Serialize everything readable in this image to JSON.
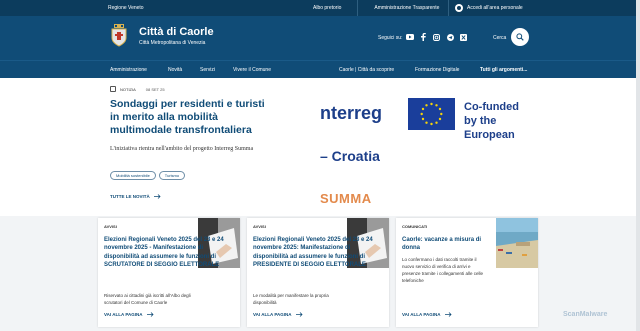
{
  "topbar": {
    "region": "Regione Veneto",
    "links": [
      "Albo pretorio",
      "Amministrazione Trasparente"
    ],
    "login": "Accedi all'area personale"
  },
  "header": {
    "site_name": "Città di Caorle",
    "site_sub": "Città Metropolitana di Venezia",
    "follow_label": "Seguici su:",
    "social_icons": [
      "youtube-icon",
      "facebook-icon",
      "instagram-icon",
      "telegram-icon",
      "x-icon"
    ],
    "search_label": "Cerca"
  },
  "nav": {
    "left": [
      "Amministrazione",
      "Novità",
      "Servizi",
      "Vivere il Comune"
    ],
    "right": [
      "Caorle | Città da scoprire",
      "Formazione Digitale"
    ],
    "all_topics": "Tutti gli argomenti..."
  },
  "hero": {
    "badge": "NOTIZIA",
    "date": "08 SET 25",
    "title": "Sondaggi per residenti e turisti in merito alla mobilità multimodale transfrontaliera",
    "description": "L'iniziativa rientra nell'ambito del progetto Interreg Summa",
    "chips": [
      "Mobilità sostenibile",
      "Turismo"
    ],
    "all_news": "TUTTE LE NOVITÀ",
    "image_text": {
      "interreg": "nterreg",
      "cofunded": "Co-funded by the European",
      "croatia": "– Croatia",
      "summa": "SUMMA"
    }
  },
  "cards": [
    {
      "category": "AVVISI",
      "title": "Elezioni Regionali Veneto 2025 del 23 e 24 novembre 2025 - Manifestazione di disponibilità ad assumere le funzioni di SCRUTATORE DI SEGGIO ELETTORALE",
      "text": "Riservato ai cittadini già iscritti all'Albo degli scrutatori del Comune di Caorle",
      "link": "VAI ALLA PAGINA"
    },
    {
      "category": "AVVISI",
      "title": "Elezioni Regionali Veneto 2025 del 23 e 24 novembre 2025: Manifestazione di disponibilità ad assumere le funzioni di PRESIDENTE DI SEGGIO ELETTORALE",
      "text": "Le modalità per manifestare la propria disponibilità",
      "link": "VAI ALLA PAGINA"
    },
    {
      "category": "COMUNICATI",
      "title": "Caorle: vacanze a misura di donna",
      "text": "Lo confermano i dati raccolti tramite il nuovo servizio di verifica di arrivi e presenze tramite i collegamenti alle celle telefoniche",
      "link": "VAI ALLA PAGINA"
    }
  ],
  "watermark": "ScanMalware"
}
